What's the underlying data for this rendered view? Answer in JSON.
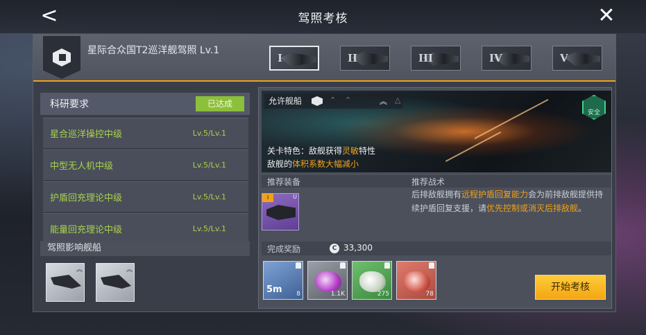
{
  "window": {
    "title": "驾照考核"
  },
  "license": {
    "name": "星际合众国T2巡洋舰驾照 Lv.1",
    "tiers": [
      "I",
      "II",
      "III",
      "IV",
      "V"
    ],
    "active_tier_index": 0
  },
  "requirements": {
    "title": "科研要求",
    "status": "已达成",
    "items": [
      {
        "name": "星合巡洋操控中级",
        "level": "Lv.5/Lv.1"
      },
      {
        "name": "中型无人机中级",
        "level": "Lv.5/Lv.1"
      },
      {
        "name": "护盾回充理论中级",
        "level": "Lv.5/Lv.1"
      },
      {
        "name": "能量回充理论中级",
        "level": "Lv.5/Lv.1"
      }
    ]
  },
  "affected_ships": {
    "title": "驾照影响舰船"
  },
  "stage": {
    "allowed_label": "允许舰船",
    "safety": "安全",
    "feature_prefix": "关卡特色：敌舰获得",
    "feature_hl": "灵敏",
    "feature_suffix": "特性",
    "line2_prefix": "敌舰的",
    "line2_hl": "体积系数大幅减小"
  },
  "sections": {
    "equipment": "推荐装备",
    "tactics": "推荐战术"
  },
  "tactics": {
    "t1": "后排敌舰拥有",
    "t2": "远程护盾回复能力",
    "t3": "会为前排敌舰提供持续护盾回复支援，请",
    "t4": "优先控制或消灭后排敌舰",
    "t5": "。"
  },
  "equipment": {
    "level_tag": "I",
    "grade": "U"
  },
  "rewards": {
    "label": "完成奖励",
    "coin_symbol": "C",
    "amount": "33,300",
    "items": [
      {
        "kind": "time",
        "main": "5m",
        "count": "8"
      },
      {
        "kind": "purple",
        "count": "1.1K"
      },
      {
        "kind": "green",
        "count": "275"
      },
      {
        "kind": "red",
        "count": "78"
      }
    ]
  },
  "actions": {
    "back": "<",
    "close": "✕",
    "start": "开始考核"
  },
  "colors": {
    "accent": "#f0a21a",
    "achieved": "#8cbf3a",
    "req_text": "#a8d24a"
  }
}
